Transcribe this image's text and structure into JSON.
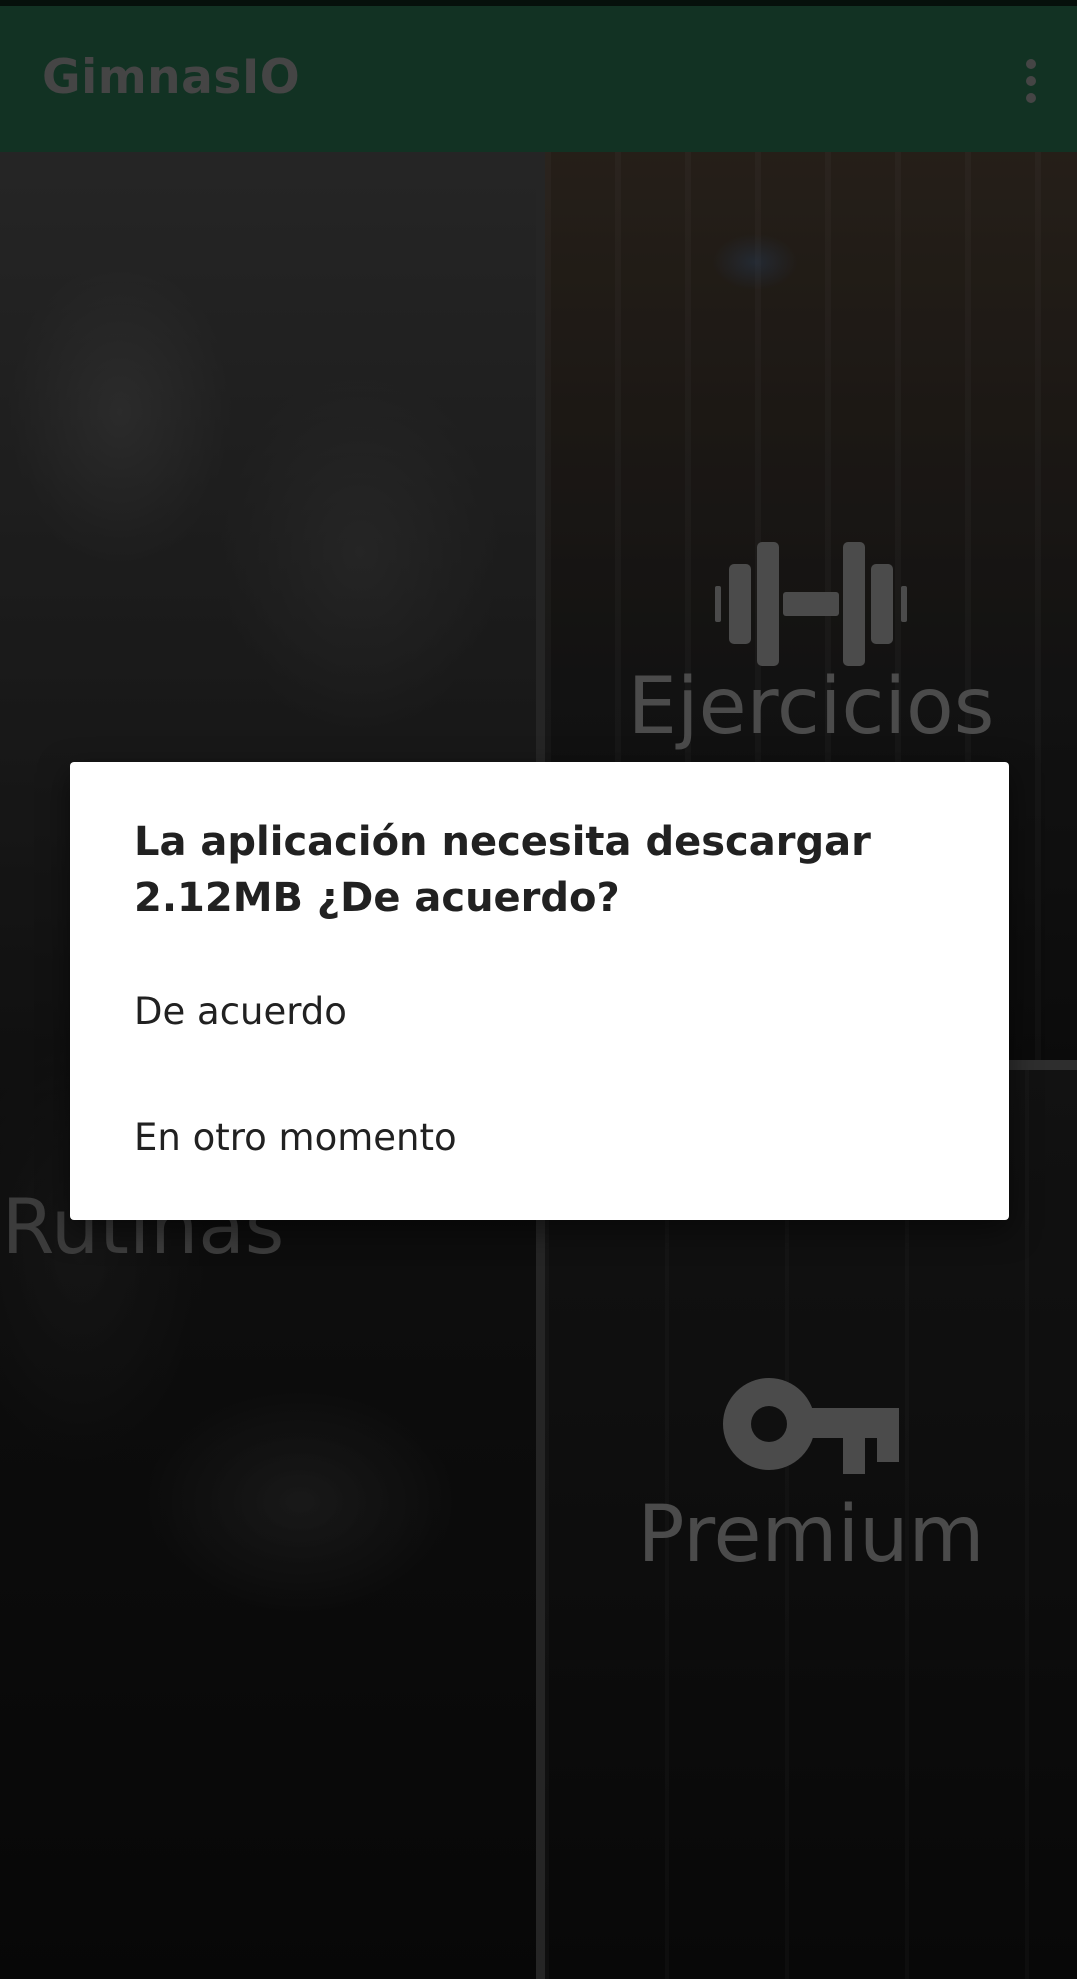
{
  "app_bar": {
    "title": "GimnasIO",
    "menu_icon": "more-vert-icon"
  },
  "tiles": {
    "rutinas": {
      "label": "Rutinas",
      "icon": "notepad-icon"
    },
    "ejercicios": {
      "label": "Ejercicios",
      "icon": "dumbbell-icon"
    },
    "premium": {
      "label": "Premium",
      "icon": "key-icon"
    }
  },
  "dialog": {
    "title": "La aplicación necesita descargar 2.12MB ¿De acuerdo?",
    "options": [
      {
        "label": "De acuerdo"
      },
      {
        "label": "En otro momento"
      }
    ]
  },
  "colors": {
    "app_bar": "#1c4e37",
    "dialog_background": "#ffffff",
    "dialog_text": "#212121"
  }
}
